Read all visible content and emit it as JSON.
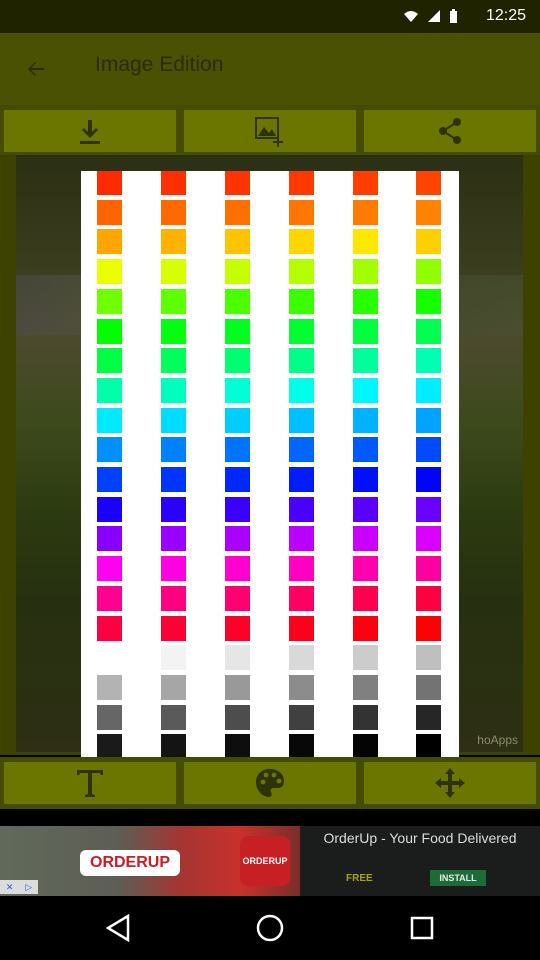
{
  "status_bar": {
    "time": "12:25"
  },
  "app_bar": {
    "title": "Image Edition"
  },
  "top_toolbar": {
    "buttons": [
      "download-icon",
      "add-image-icon",
      "share-icon"
    ]
  },
  "bottom_toolbar": {
    "buttons": [
      "text-icon",
      "palette-icon",
      "move-icon"
    ]
  },
  "image_area": {
    "watermark": "hoApps"
  },
  "ad": {
    "logo_text": "ORDERUP",
    "icon_text": "ORDERUP",
    "title": "OrderUp - Your Food Delivered",
    "price_label": "FREE",
    "cta": "INSTALL"
  },
  "color_picker": {
    "columns": 6,
    "rows": [
      [
        "#ff2a00",
        "#ff2f00",
        "#ff3400",
        "#ff3900",
        "#ff3e00",
        "#ff4300"
      ],
      [
        "#ff6400",
        "#ff6a00",
        "#ff7000",
        "#ff7600",
        "#ff7c00",
        "#ff8200"
      ],
      [
        "#ffa600",
        "#ffb200",
        "#ffc400",
        "#ffd600",
        "#ffe800",
        "#ffd000"
      ],
      [
        "#eaff00",
        "#d8ff00",
        "#c6ff00",
        "#b4ff00",
        "#a2ff00",
        "#90ff00"
      ],
      [
        "#70ff00",
        "#5eff00",
        "#4cff00",
        "#3aff00",
        "#28ff00",
        "#16ff00"
      ],
      [
        "#00ff00",
        "#00ff10",
        "#00ff20",
        "#00ff30",
        "#00ff40",
        "#00ff50"
      ],
      [
        "#00ff44",
        "#00ff5a",
        "#00ff70",
        "#00ff86",
        "#00ff9c",
        "#00ffb2"
      ],
      [
        "#00ffa8",
        "#00ffbe",
        "#00ffd4",
        "#00ffea",
        "#00f6ff",
        "#00ecff"
      ],
      [
        "#00eaff",
        "#00dcff",
        "#00ceff",
        "#00c0ff",
        "#00b2ff",
        "#00a4ff"
      ],
      [
        "#0090ff",
        "#0082ff",
        "#0074ff",
        "#0066ff",
        "#0058ff",
        "#004aff"
      ],
      [
        "#0040ff",
        "#0034ff",
        "#0028ff",
        "#001cff",
        "#0010ff",
        "#0004ff"
      ],
      [
        "#1a00ff",
        "#2a00ff",
        "#3a00ff",
        "#4a00ff",
        "#5a00ff",
        "#6a00ff"
      ],
      [
        "#8a00ff",
        "#9a00ff",
        "#aa00ff",
        "#ba00ff",
        "#ca00ff",
        "#da00ff"
      ],
      [
        "#ff00f0",
        "#ff00e0",
        "#ff00d0",
        "#ff00c0",
        "#ff00b0",
        "#ff00a0"
      ],
      [
        "#ff0090",
        "#ff0080",
        "#ff0070",
        "#ff0060",
        "#ff0050",
        "#ff0040"
      ],
      [
        "#ff0040",
        "#ff0034",
        "#ff0028",
        "#ff001c",
        "#ff0010",
        "#ff0004"
      ],
      [
        "#ffffff",
        "#f3f3f3",
        "#e6e6e6",
        "#d9d9d9",
        "#cccccc",
        "#bfbfbf"
      ],
      [
        "#b3b3b3",
        "#a6a6a6",
        "#999999",
        "#8c8c8c",
        "#808080",
        "#737373"
      ],
      [
        "#666666",
        "#5a5a5a",
        "#4d4d4d",
        "#404040",
        "#333333",
        "#262626"
      ],
      [
        "#1a1a1a",
        "#141414",
        "#0e0e0e",
        "#080808",
        "#040404",
        "#000000"
      ]
    ]
  },
  "nav_bar": {
    "buttons": [
      "back-nav-icon",
      "home-nav-icon",
      "recents-nav-icon"
    ]
  }
}
